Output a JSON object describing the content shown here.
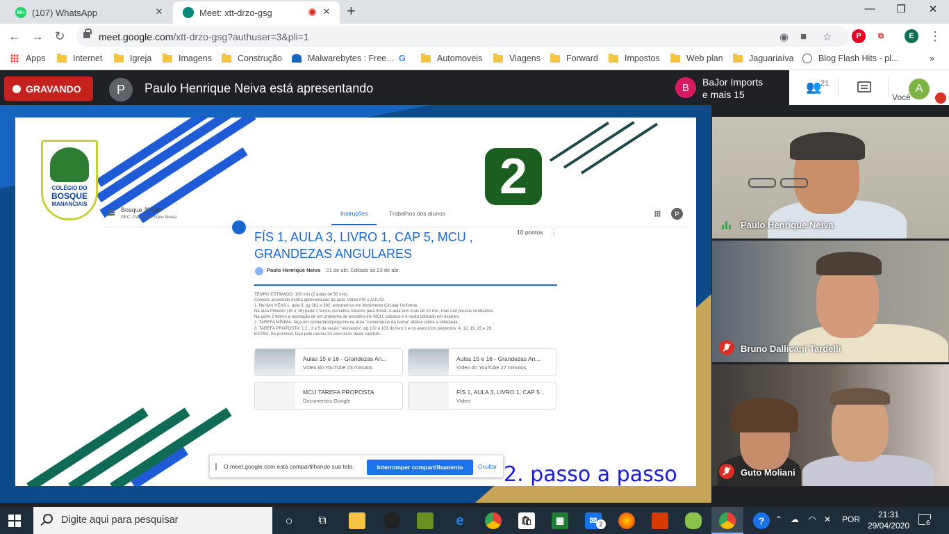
{
  "browser": {
    "tabs": [
      {
        "title": "(107) WhatsApp",
        "badge": "99+"
      },
      {
        "title": "Meet: xtt-drzo-gsg"
      }
    ],
    "url_host": "meet.google.com",
    "url_path": "/xtt-drzo-gsg?authuser=3&pli=1",
    "profile_letter": "E",
    "bookmarks": [
      "Apps",
      "Internet",
      "Igreja",
      "Imagens",
      "Construção",
      "Malwarebytes : Free...",
      "Automoveis",
      "Viagens",
      "Forward",
      "Impostos",
      "Web plan",
      "Jaguariaíva",
      "Blog Flash Hits - pl..."
    ]
  },
  "meet": {
    "recording_label": "GRAVANDO",
    "presenter_initial": "P",
    "presenter_text": "Paulo Henrique Neiva está apresentando",
    "others_initial": "B",
    "others_line1": "BaJor Imports",
    "others_line2": "e mais 15",
    "participant_count": "21",
    "self_label": "Você",
    "self_initial": "A",
    "participants": [
      {
        "name": "Paulo Henrique Neiva",
        "status": "speaking"
      },
      {
        "name": "Bruno Dallicani Tardelli",
        "status": "muted"
      },
      {
        "name": "Guto Moliani",
        "status": "muted"
      }
    ]
  },
  "slide": {
    "logo_line1": "COLÉGIO DO",
    "logo_line2": "BOSQUE",
    "logo_line3": "MANANCIAIS",
    "big_number": "2",
    "course_name": "Bosque 3º EM",
    "course_sub": "PEC: Paulo Henrique Neiva",
    "tab_instructions": "Instruções",
    "tab_student_work": "Trabalhos dos alunos",
    "profile_initial": "P",
    "assignment_title": "FÍS 1, AULA 3, LIVRO 1, CAP 5, MCU , GRANDEZAS ANGULARES",
    "points": "10 pontos",
    "author": "Paulo Henrique Neiva",
    "dates": "21 de abr. Editado às 23 de abr.",
    "description": "TEMPO ESTIMADO: 100 min (2 aulas de 50 min)\nComece assistindo minha apresentação da aula: Vídeo FIS 1 AULA3.\n1. No livro HEXA 1, aula 8, pg 381 e 382, entraremos em Movimento Circular Uniforme.\nNa aula Poliedro (15 e 16) parte 1 temos conceitos básicos para firmar. A aula tem mais de 20 min, mas são poucos conteúdos.\nNa parte 2 temos a resolução de um problema de encontro em MCU, clássico e é muito utilizado em exames.\n2. TAREFA MÍNIMA: faça um comentário/pergunta na área \"comentários da turma\" abaixo sobre a videoaula.\n3. TAREFA PROPOSTA: 1,2 , 3 e 5 da seção \"revisando\". pg 102 e 103 do livro 1 e os exercícios propostos: 4, 12, 19, 25 e 28.\nEXTRA: Se possível, faça pelo menos 20 exercícios deste capítulo.",
    "attachments": [
      {
        "title": "Aulas 15 e 16 - Grandezas An...",
        "sub": "Vídeo do YouTube   23 minutos",
        "kind": "vid"
      },
      {
        "title": "Aulas 15 e 16 - Grandezas An...",
        "sub": "Vídeo do YouTube   27 minutos",
        "kind": "vid"
      },
      {
        "title": "MCU TAREFA PROPOSTA",
        "sub": "Documentos Google",
        "kind": "doc"
      },
      {
        "title": "FÍS 1, AULA 3, LIVRO 1, CAP 5...",
        "sub": "Vídeo",
        "kind": "doc"
      }
    ],
    "share_message": "O meet.google.com está compartilhando sua tela.",
    "stop_sharing": "Interromper compartilhamento",
    "hide": "Ocultar",
    "caption": "2. passo a passo"
  },
  "taskbar": {
    "search_placeholder": "Digite aqui para pesquisar",
    "mail_badge": "2",
    "language": "POR",
    "time": "21:31",
    "date": "29/04/2020",
    "notifications": "6"
  },
  "colors": {
    "record_red": "#c5221f",
    "meet_dark": "#202124",
    "classroom_blue": "#1967d2",
    "stripe_blue": "#1f5bd6"
  }
}
